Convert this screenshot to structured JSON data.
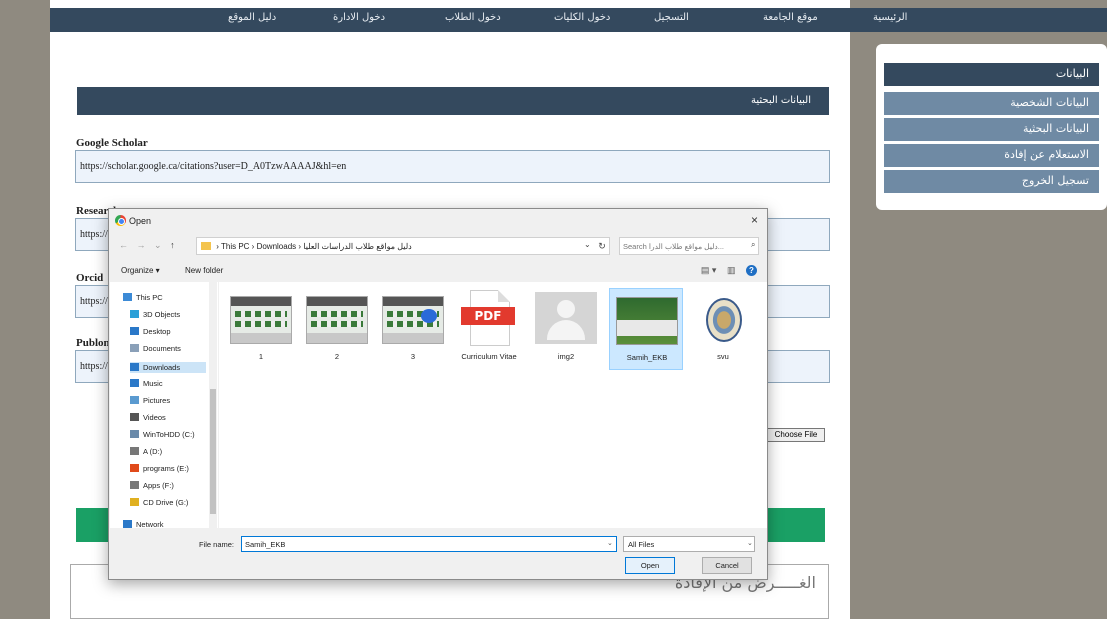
{
  "topnav": {
    "items": [
      "الرئيسية",
      "موقع الجامعة",
      "التسجيل",
      "دخول الكليات",
      "دخول الطلاب",
      "دخول الادارة",
      "دليل الموقع"
    ]
  },
  "page": {
    "section_title": "البيانات البحثية",
    "fields": [
      {
        "label": "Google Scholar",
        "value": "https://scholar.google.ca/citations?user=D_A0TzwAAAAJ&hl=en"
      },
      {
        "label": "Researchgate",
        "value": "https://"
      },
      {
        "label": "Orcid",
        "value": "https://"
      },
      {
        "label": "Publons",
        "value": "https://"
      }
    ],
    "choose_file": "Choose File",
    "textarea_text": "الغـــــرض من الإفادة"
  },
  "sidebar": {
    "header": "البيانات",
    "items": [
      "البيانات الشخصية",
      "البيانات البحثية",
      "الاستعلام عن إفادة",
      "تسجيل الخروج"
    ]
  },
  "dialog": {
    "title": "Open",
    "close": "×",
    "nav_arrows": [
      "←",
      "→",
      "⌄",
      "↑"
    ],
    "address": {
      "pc": "This PC",
      "folder1": "Downloads",
      "folder2": "دليل مواقع طلاب الدراسات العليا",
      "sep": "›"
    },
    "search_placeholder": "Search دليل مواقع طلاب الدرا...",
    "toolbar": {
      "organize": "Organize ▾",
      "new_folder": "New folder"
    },
    "nav_items": [
      {
        "label": "This PC",
        "icon": "computer-icon",
        "color": "#3c8ad6"
      },
      {
        "label": "3D Objects",
        "icon": "cube-icon",
        "color": "#2aa0d8"
      },
      {
        "label": "Desktop",
        "icon": "desktop-icon",
        "color": "#2a78c8"
      },
      {
        "label": "Documents",
        "icon": "document-icon",
        "color": "#8aa0b8"
      },
      {
        "label": "Downloads",
        "icon": "download-icon",
        "color": "#2a78c8"
      },
      {
        "label": "Music",
        "icon": "music-icon",
        "color": "#2a78c8"
      },
      {
        "label": "Pictures",
        "icon": "pictures-icon",
        "color": "#5a9ad0"
      },
      {
        "label": "Videos",
        "icon": "video-icon",
        "color": "#555555"
      },
      {
        "label": "WinToHDD (C:)",
        "icon": "drive-icon",
        "color": "#6a8aaa"
      },
      {
        "label": "A (D:)",
        "icon": "drive-icon",
        "color": "#777777"
      },
      {
        "label": "programs (E:)",
        "icon": "office-icon",
        "color": "#e04a1a"
      },
      {
        "label": "Apps (F:)",
        "icon": "drive-icon",
        "color": "#777777"
      },
      {
        "label": "CD Drive (G:)",
        "icon": "cd-icon",
        "color": "#e0b020"
      },
      {
        "label": "Network",
        "icon": "network-icon",
        "color": "#2a78c8"
      }
    ],
    "files": [
      {
        "name": "1",
        "kind": "site"
      },
      {
        "name": "2",
        "kind": "site"
      },
      {
        "name": "3",
        "kind": "site"
      },
      {
        "name": "Curriculum Vitae",
        "kind": "pdf",
        "badge": "PDF"
      },
      {
        "name": "img2",
        "kind": "avatar"
      },
      {
        "name": "Samih_EKB",
        "kind": "green",
        "selected": true
      },
      {
        "name": "svu",
        "kind": "seal"
      }
    ],
    "file_name_label": "File name:",
    "file_name_value": "Samih_EKB",
    "file_type": "All Files",
    "open_button": "Open",
    "cancel_button": "Cancel"
  }
}
